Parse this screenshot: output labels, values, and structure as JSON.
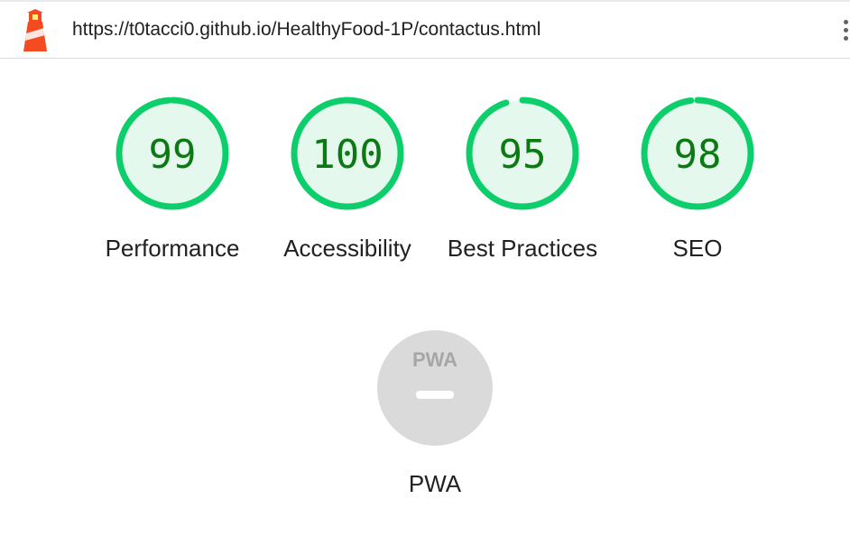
{
  "header": {
    "url": "https://t0tacci0.github.io/HealthyFood-1P/contactus.html",
    "logo_icon": "lighthouse-icon",
    "menu_icon": "kebab-menu-icon"
  },
  "colors": {
    "pass_ring": "#0cce6b",
    "pass_fill": "#e5f8ed",
    "pass_text": "#0b7a13",
    "pwa_circle": "#dadada"
  },
  "gauges": [
    {
      "score": "99",
      "value": 99,
      "label": "Performance"
    },
    {
      "score": "100",
      "value": 100,
      "label": "Accessibility"
    },
    {
      "score": "95",
      "value": 95,
      "label": "Best Practices"
    },
    {
      "score": "98",
      "value": 98,
      "label": "SEO"
    }
  ],
  "pwa": {
    "badge_text": "PWA",
    "label": "PWA"
  }
}
